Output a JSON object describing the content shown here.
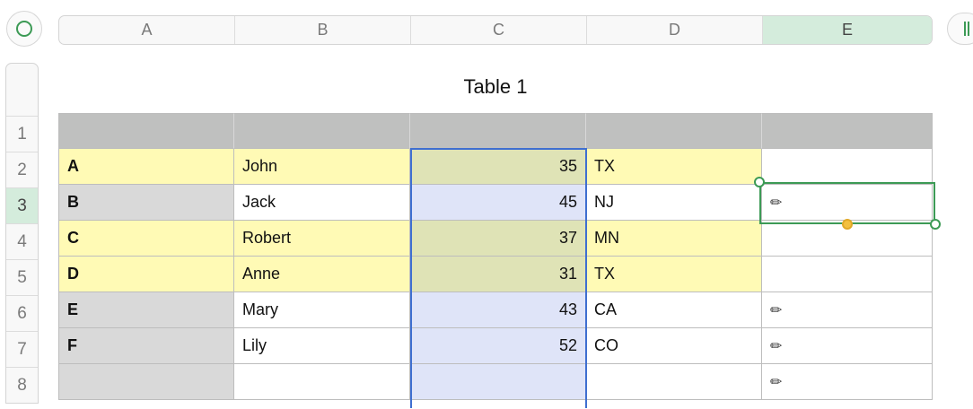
{
  "columns": [
    "A",
    "B",
    "C",
    "D",
    "E"
  ],
  "active_column": "E",
  "row_numbers": [
    "1",
    "2",
    "3",
    "4",
    "5",
    "6",
    "7",
    "8"
  ],
  "active_row": "3",
  "table_title": "Table 1",
  "colors": {
    "header_fill": "#bfc0bf",
    "yellow_fill": "#fffab5",
    "gray_fill": "#d9d9d9",
    "olive_fill": "#dfe3b6",
    "blue_fill": "#dfe4f8",
    "selection_green": "#3c9a55",
    "selection_blue": "#3f6fd0"
  },
  "rows": [
    {
      "a": "",
      "b": "",
      "c": "",
      "d": "",
      "e": "",
      "e_icon": ""
    },
    {
      "a": "A",
      "b": "John",
      "c": "35",
      "d": "TX",
      "e": "",
      "e_icon": ""
    },
    {
      "a": "B",
      "b": "Jack",
      "c": "45",
      "d": "NJ",
      "e": "",
      "e_icon": "pencil-icon"
    },
    {
      "a": "C",
      "b": "Robert",
      "c": "37",
      "d": "MN",
      "e": "",
      "e_icon": ""
    },
    {
      "a": "D",
      "b": "Anne",
      "c": "31",
      "d": "TX",
      "e": "",
      "e_icon": ""
    },
    {
      "a": "E",
      "b": "Mary",
      "c": "43",
      "d": "CA",
      "e": "",
      "e_icon": "pencil-icon"
    },
    {
      "a": "F",
      "b": "Lily",
      "c": "52",
      "d": "CO",
      "e": "",
      "e_icon": "pencil-icon"
    },
    {
      "a": "",
      "b": "",
      "c": "",
      "d": "",
      "e": "",
      "e_icon": "pencil-icon"
    }
  ],
  "pencil_glyph": "✏"
}
